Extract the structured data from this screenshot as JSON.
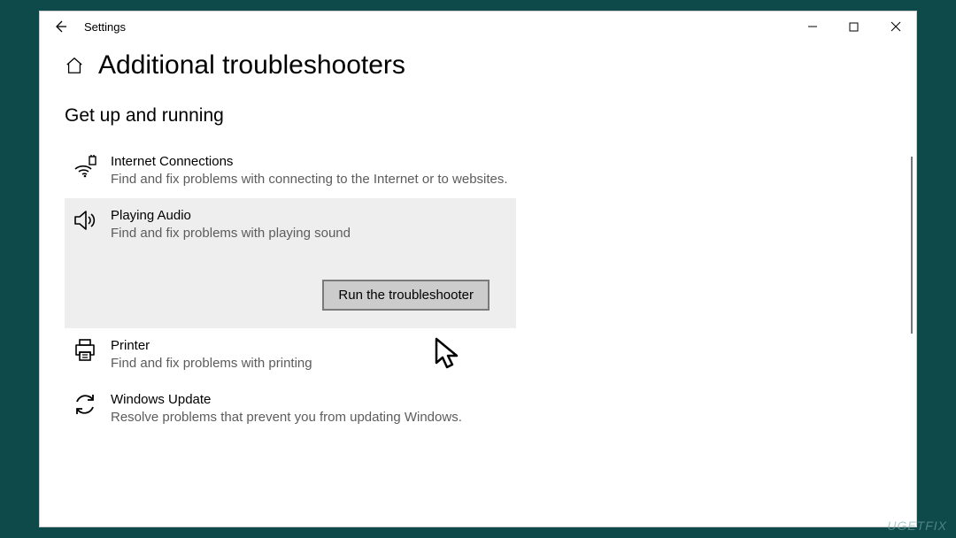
{
  "titlebar": {
    "app_title": "Settings"
  },
  "page": {
    "title": "Additional troubleshooters"
  },
  "section": {
    "title": "Get up and running"
  },
  "troubleshooters": [
    {
      "title": "Internet Connections",
      "desc": "Find and fix problems with connecting to the Internet or to websites."
    },
    {
      "title": "Playing Audio",
      "desc": "Find and fix problems with playing sound"
    },
    {
      "title": "Printer",
      "desc": "Find and fix problems with printing"
    },
    {
      "title": "Windows Update",
      "desc": "Resolve problems that prevent you from updating Windows."
    }
  ],
  "run_button": {
    "label": "Run the troubleshooter"
  },
  "watermark": "UGETFIX"
}
